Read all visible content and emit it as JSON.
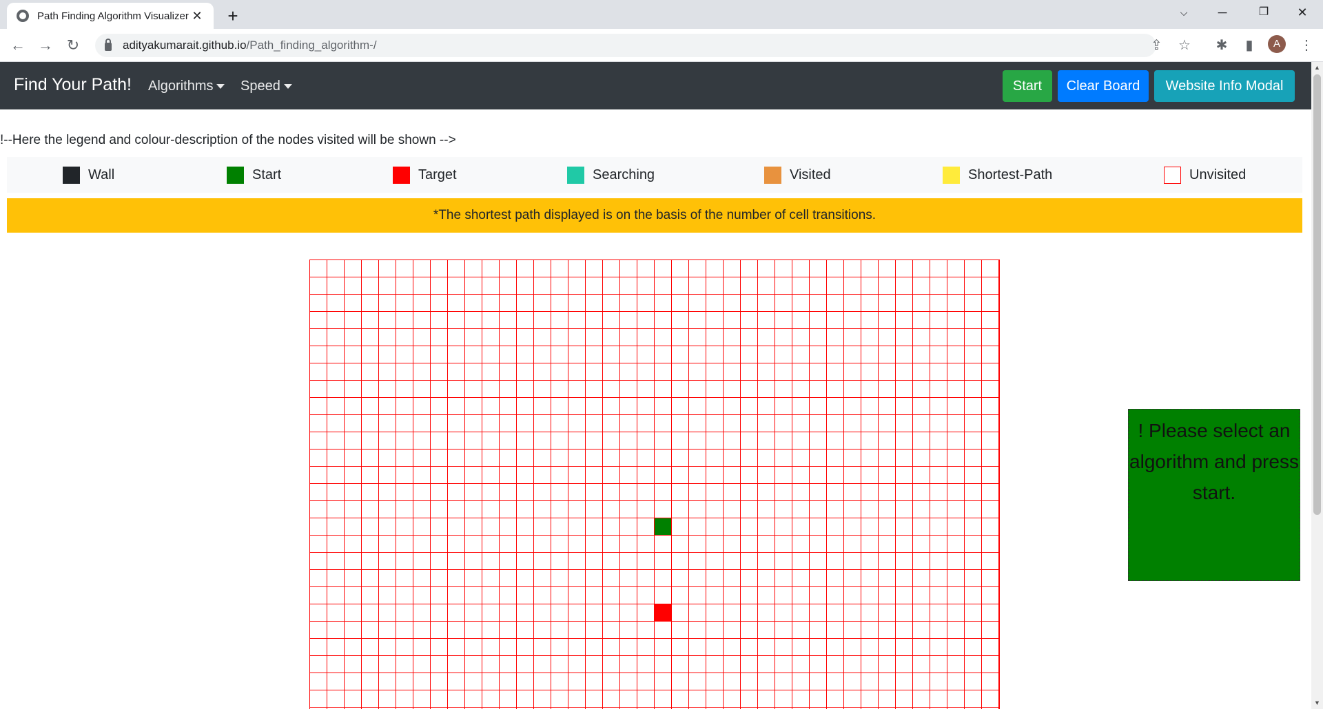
{
  "browser": {
    "tab_title": "Path Finding Algorithm Visualizer",
    "tab_close": "✕",
    "new_tab": "+",
    "url_domain": "adityakumarait.github.io",
    "url_path": "/Path_finding_algorithm-/",
    "profile_initial": "A"
  },
  "navbar": {
    "brand": "Find Your Path!",
    "algorithms_label": "Algorithms",
    "speed_label": "Speed",
    "start_label": "Start",
    "clear_label": "Clear Board",
    "info_label": "Website Info Modal",
    "colors": {
      "background": "#343a40",
      "start": "#28a745",
      "clear": "#007bff",
      "info": "#17a2b8"
    }
  },
  "page": {
    "comment": "!--Here the legend and colour-description of the nodes visited will be shown -->",
    "notice": "*The shortest path displayed is on the basis of the number of cell transitions.",
    "message": "! Please select an algorithm and press start."
  },
  "legend": [
    {
      "label": "Wall",
      "color": "#212529"
    },
    {
      "label": "Start",
      "color": "#008000"
    },
    {
      "label": "Target",
      "color": "#ff0000"
    },
    {
      "label": "Searching",
      "color": "#20c9a6"
    },
    {
      "label": "Visited",
      "color": "#e8923e"
    },
    {
      "label": "Shortest-Path",
      "color": "#ffeb3b"
    },
    {
      "label": "Unvisited",
      "color": "#ffffff",
      "border": "#ff0000"
    }
  ],
  "grid": {
    "visible_columns": 40,
    "visible_rows": 26,
    "line_color": "#ff0000",
    "start_cell": {
      "row": 15,
      "col": 20,
      "color": "#008000"
    },
    "target_cell": {
      "row": 20,
      "col": 20,
      "color": "#ff0000"
    }
  }
}
